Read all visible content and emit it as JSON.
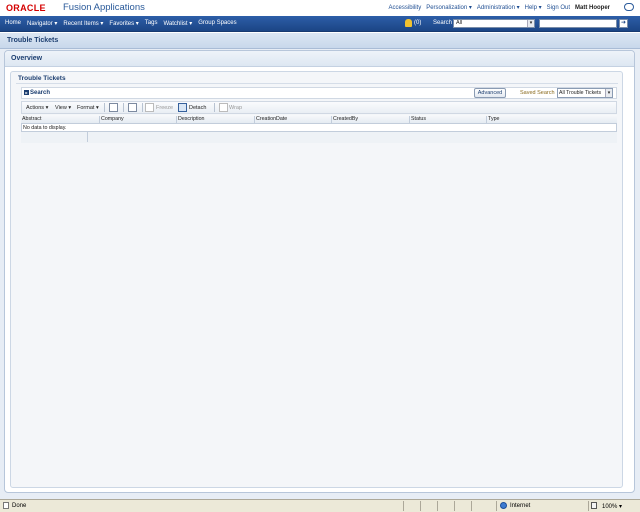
{
  "branding": {
    "logo": "ORACLE",
    "product": "Fusion Applications",
    "links": [
      "Accessibility",
      "Personalization ▾",
      "Administration ▾",
      "Help ▾",
      "Sign Out"
    ],
    "user": "Matt Hooper"
  },
  "navbar": {
    "items": [
      "Home",
      "Navigator ▾",
      "Recent Items ▾",
      "Favorites ▾",
      "Tags",
      "Watchlist ▾",
      "Group Spaces"
    ],
    "notifications": "(0)",
    "search_label": "Search",
    "search_scope": "All",
    "search_value": "",
    "go_label": "➜"
  },
  "page": {
    "title": "Trouble Tickets"
  },
  "overview": {
    "title": "Overview",
    "panel_title": "Trouble Tickets"
  },
  "search": {
    "toggle_label": "Search",
    "toggle_arrow": "▸",
    "advanced_label": "Advanced",
    "saved_search_label": "Saved Search",
    "saved_search_value": "All Trouble Tickets"
  },
  "toolbar": {
    "actions": "Actions ▾",
    "view": "View ▾",
    "format": "Format ▾",
    "freeze": "Freeze",
    "detach": "Detach",
    "wrap": "Wrap"
  },
  "table": {
    "columns": [
      "Abstract",
      "Company",
      "Description",
      "CreationDate",
      "CreatedBy",
      "Status",
      "Type"
    ],
    "empty_message": "No data to display."
  },
  "statusbar": {
    "status": "Done",
    "zone": "Internet",
    "zoom": "100% ▾"
  },
  "colors": {
    "oracle_red": "#d40000",
    "nav_blue": "#1b4585",
    "title_blue": "#1c3e70"
  }
}
